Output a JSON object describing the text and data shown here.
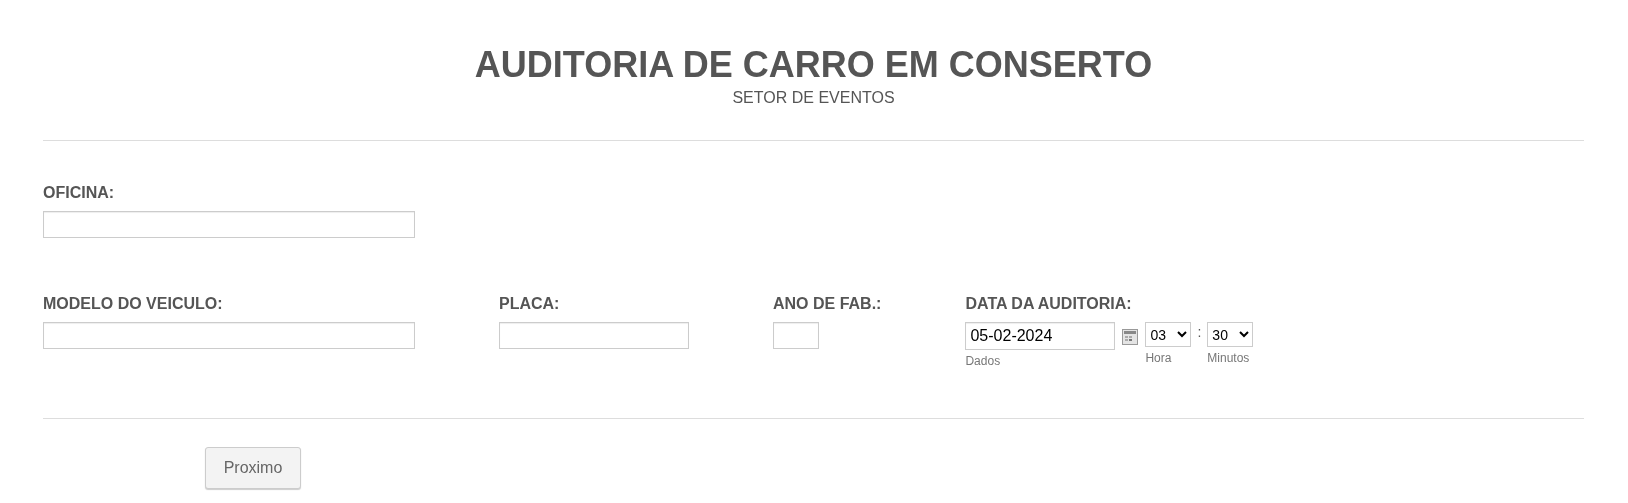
{
  "header": {
    "title": "AUDITORIA DE CARRO EM CONSERTO",
    "subtitle": "SETOR DE EVENTOS"
  },
  "fields": [
    {
      "label": "OFICINA:"
    }
  ],
  "row": [
    {
      "label": "MODELO DO VEICULO:",
      "kind": "text"
    },
    {
      "label": "PLACA:",
      "kind": "text"
    },
    {
      "label": "ANO DE FAB.:",
      "kind": "text"
    },
    {
      "label": "DATA DA AUDITORIA:",
      "kind": "datetime",
      "date": {
        "value": "05-02-2024",
        "sublabel": "Dados"
      },
      "hour": {
        "value": "03",
        "sublabel": "Hora"
      },
      "separator": ":",
      "minute": {
        "value": "30",
        "sublabel": "Minutos"
      }
    }
  ],
  "button": "Proximo"
}
